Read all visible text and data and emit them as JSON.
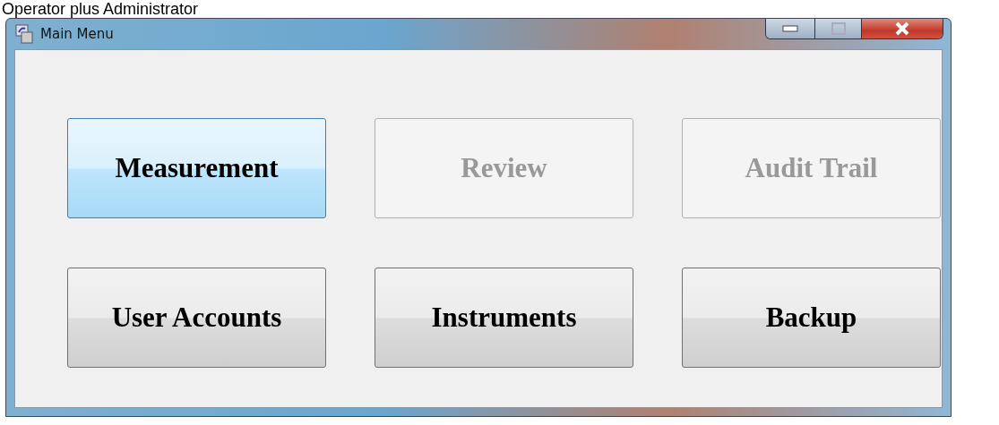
{
  "caption": "Operator plus Administrator",
  "window": {
    "title": "Main Menu"
  },
  "buttons": [
    {
      "label": "Measurement",
      "disabled": false,
      "focused": true
    },
    {
      "label": "Review",
      "disabled": true,
      "focused": false
    },
    {
      "label": "Audit Trail",
      "disabled": true,
      "focused": false
    },
    {
      "label": "User Accounts",
      "disabled": false,
      "focused": false
    },
    {
      "label": "Instruments",
      "disabled": false,
      "focused": false
    },
    {
      "label": "Backup",
      "disabled": false,
      "focused": false
    }
  ]
}
